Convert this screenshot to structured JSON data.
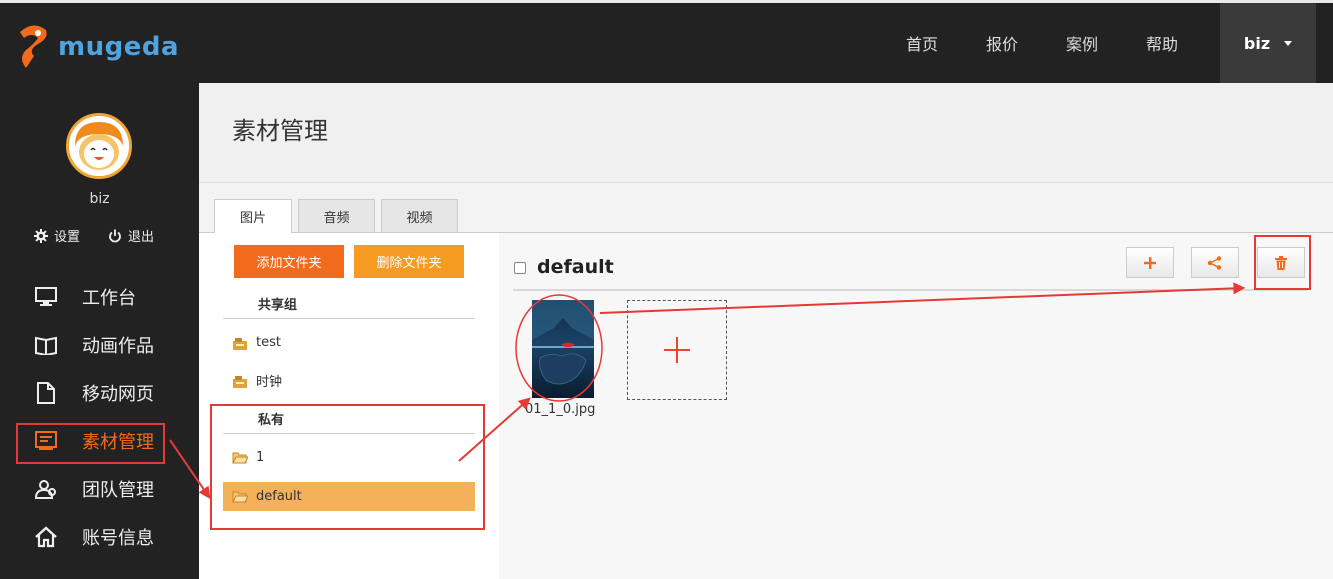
{
  "brand": {
    "name": "mugeda"
  },
  "topnav": {
    "items": [
      "首页",
      "报价",
      "案例",
      "帮助"
    ],
    "user": "biz"
  },
  "sidebar": {
    "username": "biz",
    "settings_label": "设置",
    "logout_label": "退出",
    "menu": [
      {
        "label": "工作台",
        "icon": "monitor-icon"
      },
      {
        "label": "动画作品",
        "icon": "book-icon"
      },
      {
        "label": "移动网页",
        "icon": "page-icon"
      },
      {
        "label": "素材管理",
        "icon": "asset-icon",
        "active": true
      },
      {
        "label": "团队管理",
        "icon": "team-icon"
      },
      {
        "label": "账号信息",
        "icon": "home-icon"
      }
    ]
  },
  "page": {
    "title": "素材管理"
  },
  "tabs": [
    {
      "label": "图片",
      "active": true
    },
    {
      "label": "音频"
    },
    {
      "label": "视频"
    }
  ],
  "folders": {
    "add_label": "添加文件夹",
    "delete_label": "删除文件夹",
    "shared_label": "共享组",
    "shared": [
      "test",
      "时钟"
    ],
    "private_label": "私有",
    "private": [
      "1",
      "default"
    ],
    "selected": "default"
  },
  "content": {
    "folder_title": "default",
    "files": [
      {
        "name": "01_1_0.jpg"
      }
    ],
    "tool_icons": [
      "plus-icon",
      "share-icon",
      "trash-icon"
    ]
  },
  "colors": {
    "accent": "#f26a1b",
    "annotation": "#e53935",
    "selected_folder": "#f5b05a",
    "brand_blue": "#4fa3e0"
  }
}
